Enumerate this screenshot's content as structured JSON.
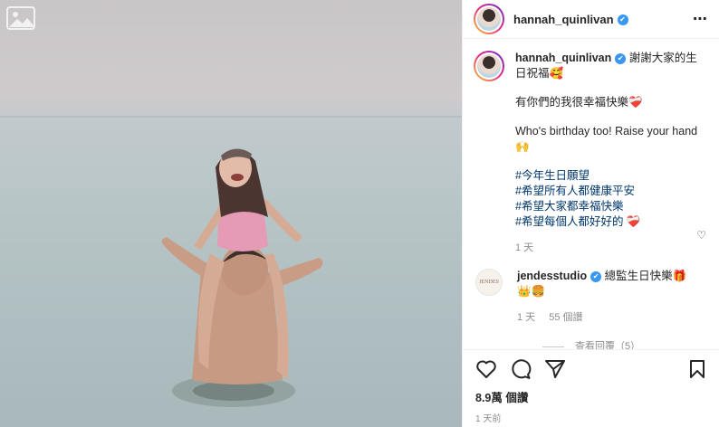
{
  "post": {
    "username": "hannah_quinlivan",
    "verified_mark": "✔",
    "more_icon": "⋯",
    "photo_badge_icon": "gallery-icon"
  },
  "caption": {
    "username": "hannah_quinlivan",
    "line1": "謝謝大家的生日祝福🥰",
    "line2": "有你們的我很幸福快樂❤️‍🩹",
    "line3": "Who's birthday too! Raise your hand 🙌",
    "hashtags": [
      "#今年生日願望",
      "#希望所有人都健康平安",
      "#希望大家都幸福快樂",
      "#希望每個人都好好的 ❤️‍🩹"
    ],
    "time": "1 天"
  },
  "comment": {
    "avatar_text": "JENDES",
    "username": "jendesstudio",
    "text": "總監生日快樂🎁",
    "text2": "👑🍔",
    "time": "1 天",
    "likes": "55 個讚",
    "view_replies": "查看回覆（5）"
  },
  "footer": {
    "likes": "8.9萬 個讚",
    "time": "1 天前"
  },
  "colors": {
    "verified": "#3897f0",
    "hashtag": "#00376b"
  }
}
